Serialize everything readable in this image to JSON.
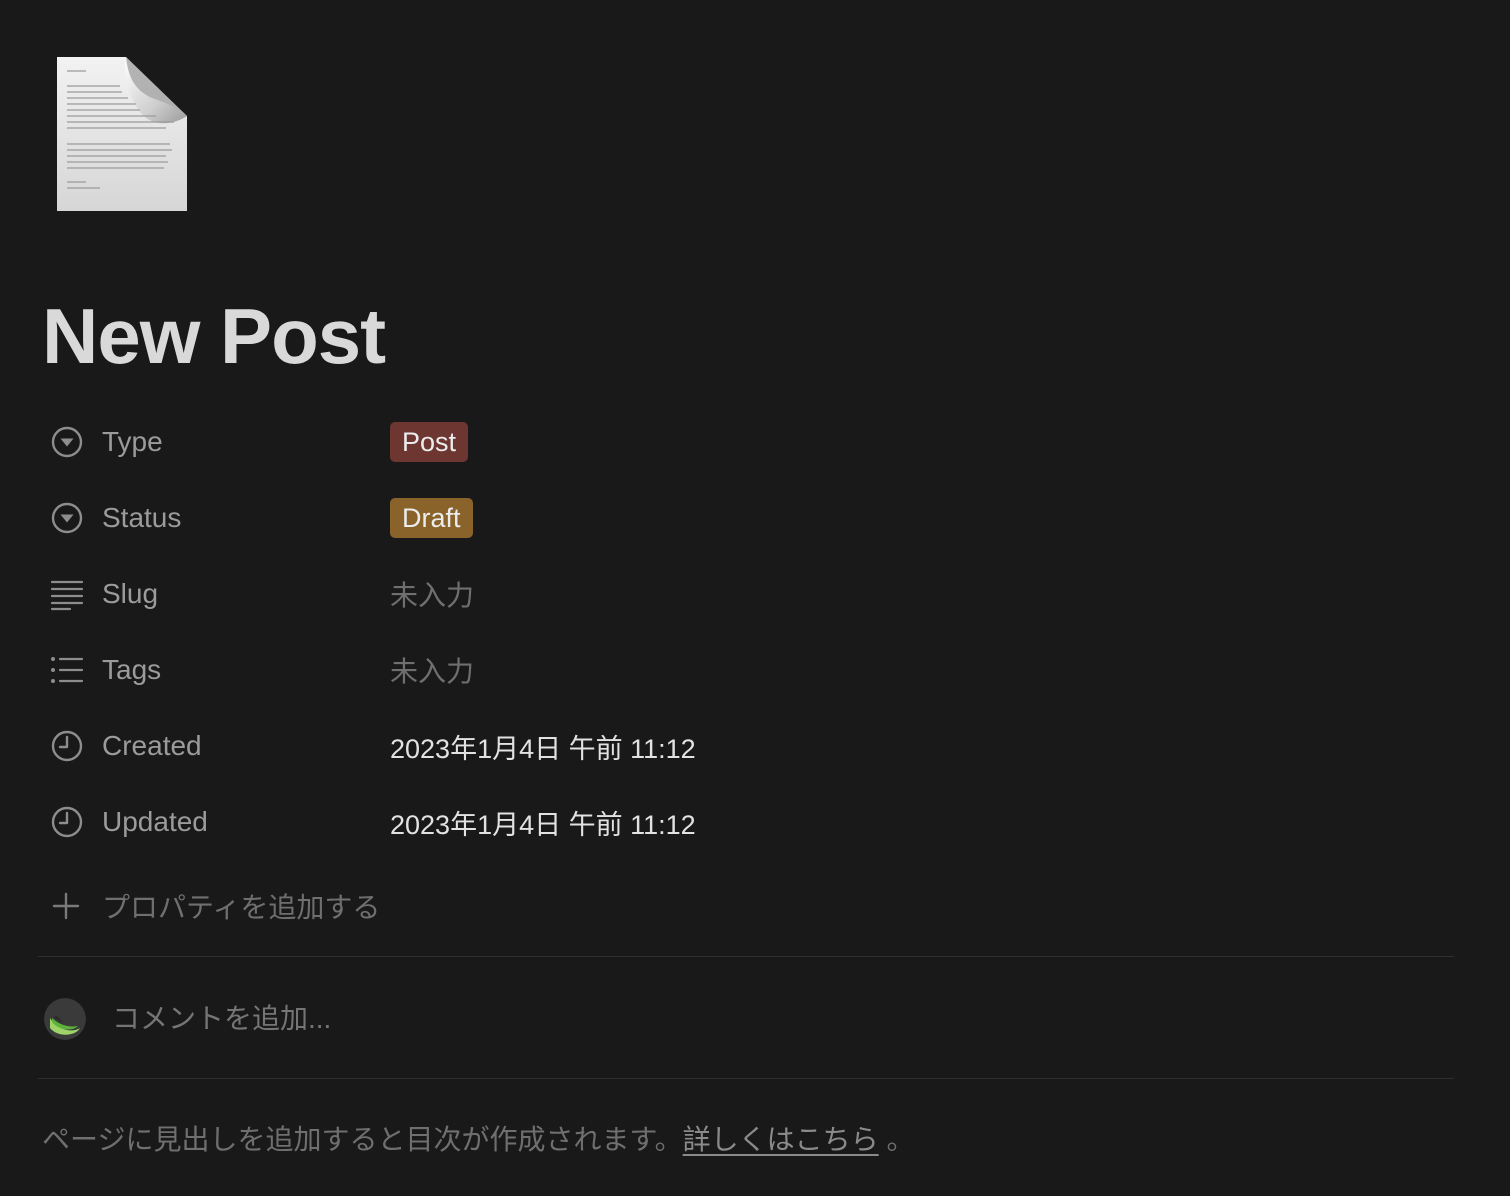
{
  "page": {
    "title": "New Post",
    "icon": "document-page-icon"
  },
  "properties": [
    {
      "key": "type",
      "label": "Type",
      "icon": "select-icon",
      "kind": "tag",
      "value": "Post",
      "color": "#6e3630"
    },
    {
      "key": "status",
      "label": "Status",
      "icon": "select-icon",
      "kind": "tag",
      "value": "Draft",
      "color": "#89632a"
    },
    {
      "key": "slug",
      "label": "Slug",
      "icon": "text-icon",
      "kind": "placeholder",
      "value": "未入力"
    },
    {
      "key": "tags",
      "label": "Tags",
      "icon": "list-icon",
      "kind": "placeholder",
      "value": "未入力"
    },
    {
      "key": "created",
      "label": "Created",
      "icon": "clock-icon",
      "kind": "datetime",
      "value": "2023年1月4日 午前 11:12"
    },
    {
      "key": "updated",
      "label": "Updated",
      "icon": "clock-icon",
      "kind": "datetime",
      "value": "2023年1月4日 午前 11:12"
    }
  ],
  "add_property": {
    "label": "プロパティを追加する",
    "icon": "plus-icon"
  },
  "comment": {
    "placeholder": "コメントを追加...",
    "avatar": "user-avatar"
  },
  "toc_hint": {
    "text": "ページに見出しを追加すると目次が作成されます。",
    "link": "詳しくはこちら",
    "suffix": " 。"
  },
  "colors": {
    "background": "#191919",
    "type_tag": "#6e3630",
    "status_tag": "#89632a"
  }
}
